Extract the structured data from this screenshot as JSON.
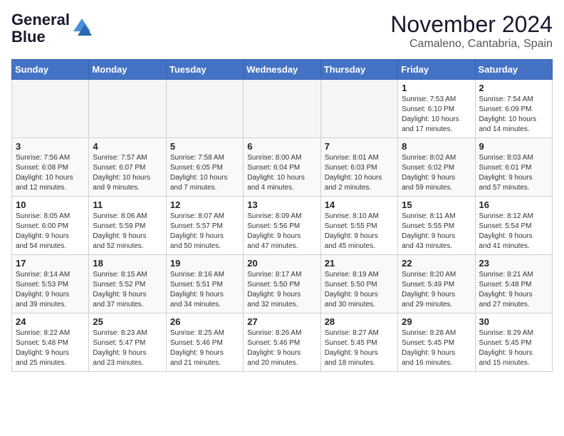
{
  "logo": {
    "line1": "General",
    "line2": "Blue"
  },
  "title": "November 2024",
  "location": "Camaleno, Cantabria, Spain",
  "days_of_week": [
    "Sunday",
    "Monday",
    "Tuesday",
    "Wednesday",
    "Thursday",
    "Friday",
    "Saturday"
  ],
  "weeks": [
    {
      "style": "white",
      "days": [
        {
          "num": "",
          "info": "",
          "empty": true
        },
        {
          "num": "",
          "info": "",
          "empty": true
        },
        {
          "num": "",
          "info": "",
          "empty": true
        },
        {
          "num": "",
          "info": "",
          "empty": true
        },
        {
          "num": "",
          "info": "",
          "empty": true
        },
        {
          "num": "1",
          "info": "Sunrise: 7:53 AM\nSunset: 6:10 PM\nDaylight: 10 hours\nand 17 minutes."
        },
        {
          "num": "2",
          "info": "Sunrise: 7:54 AM\nSunset: 6:09 PM\nDaylight: 10 hours\nand 14 minutes."
        }
      ]
    },
    {
      "style": "gray",
      "days": [
        {
          "num": "3",
          "info": "Sunrise: 7:56 AM\nSunset: 6:08 PM\nDaylight: 10 hours\nand 12 minutes."
        },
        {
          "num": "4",
          "info": "Sunrise: 7:57 AM\nSunset: 6:07 PM\nDaylight: 10 hours\nand 9 minutes."
        },
        {
          "num": "5",
          "info": "Sunrise: 7:58 AM\nSunset: 6:05 PM\nDaylight: 10 hours\nand 7 minutes."
        },
        {
          "num": "6",
          "info": "Sunrise: 8:00 AM\nSunset: 6:04 PM\nDaylight: 10 hours\nand 4 minutes."
        },
        {
          "num": "7",
          "info": "Sunrise: 8:01 AM\nSunset: 6:03 PM\nDaylight: 10 hours\nand 2 minutes."
        },
        {
          "num": "8",
          "info": "Sunrise: 8:02 AM\nSunset: 6:02 PM\nDaylight: 9 hours\nand 59 minutes."
        },
        {
          "num": "9",
          "info": "Sunrise: 8:03 AM\nSunset: 6:01 PM\nDaylight: 9 hours\nand 57 minutes."
        }
      ]
    },
    {
      "style": "white",
      "days": [
        {
          "num": "10",
          "info": "Sunrise: 8:05 AM\nSunset: 6:00 PM\nDaylight: 9 hours\nand 54 minutes."
        },
        {
          "num": "11",
          "info": "Sunrise: 8:06 AM\nSunset: 5:59 PM\nDaylight: 9 hours\nand 52 minutes."
        },
        {
          "num": "12",
          "info": "Sunrise: 8:07 AM\nSunset: 5:57 PM\nDaylight: 9 hours\nand 50 minutes."
        },
        {
          "num": "13",
          "info": "Sunrise: 8:09 AM\nSunset: 5:56 PM\nDaylight: 9 hours\nand 47 minutes."
        },
        {
          "num": "14",
          "info": "Sunrise: 8:10 AM\nSunset: 5:55 PM\nDaylight: 9 hours\nand 45 minutes."
        },
        {
          "num": "15",
          "info": "Sunrise: 8:11 AM\nSunset: 5:55 PM\nDaylight: 9 hours\nand 43 minutes."
        },
        {
          "num": "16",
          "info": "Sunrise: 8:12 AM\nSunset: 5:54 PM\nDaylight: 9 hours\nand 41 minutes."
        }
      ]
    },
    {
      "style": "gray",
      "days": [
        {
          "num": "17",
          "info": "Sunrise: 8:14 AM\nSunset: 5:53 PM\nDaylight: 9 hours\nand 39 minutes."
        },
        {
          "num": "18",
          "info": "Sunrise: 8:15 AM\nSunset: 5:52 PM\nDaylight: 9 hours\nand 37 minutes."
        },
        {
          "num": "19",
          "info": "Sunrise: 8:16 AM\nSunset: 5:51 PM\nDaylight: 9 hours\nand 34 minutes."
        },
        {
          "num": "20",
          "info": "Sunrise: 8:17 AM\nSunset: 5:50 PM\nDaylight: 9 hours\nand 32 minutes."
        },
        {
          "num": "21",
          "info": "Sunrise: 8:19 AM\nSunset: 5:50 PM\nDaylight: 9 hours\nand 30 minutes."
        },
        {
          "num": "22",
          "info": "Sunrise: 8:20 AM\nSunset: 5:49 PM\nDaylight: 9 hours\nand 29 minutes."
        },
        {
          "num": "23",
          "info": "Sunrise: 8:21 AM\nSunset: 5:48 PM\nDaylight: 9 hours\nand 27 minutes."
        }
      ]
    },
    {
      "style": "white",
      "days": [
        {
          "num": "24",
          "info": "Sunrise: 8:22 AM\nSunset: 5:48 PM\nDaylight: 9 hours\nand 25 minutes."
        },
        {
          "num": "25",
          "info": "Sunrise: 8:23 AM\nSunset: 5:47 PM\nDaylight: 9 hours\nand 23 minutes."
        },
        {
          "num": "26",
          "info": "Sunrise: 8:25 AM\nSunset: 5:46 PM\nDaylight: 9 hours\nand 21 minutes."
        },
        {
          "num": "27",
          "info": "Sunrise: 8:26 AM\nSunset: 5:46 PM\nDaylight: 9 hours\nand 20 minutes."
        },
        {
          "num": "28",
          "info": "Sunrise: 8:27 AM\nSunset: 5:45 PM\nDaylight: 9 hours\nand 18 minutes."
        },
        {
          "num": "29",
          "info": "Sunrise: 8:28 AM\nSunset: 5:45 PM\nDaylight: 9 hours\nand 16 minutes."
        },
        {
          "num": "30",
          "info": "Sunrise: 8:29 AM\nSunset: 5:45 PM\nDaylight: 9 hours\nand 15 minutes."
        }
      ]
    }
  ]
}
